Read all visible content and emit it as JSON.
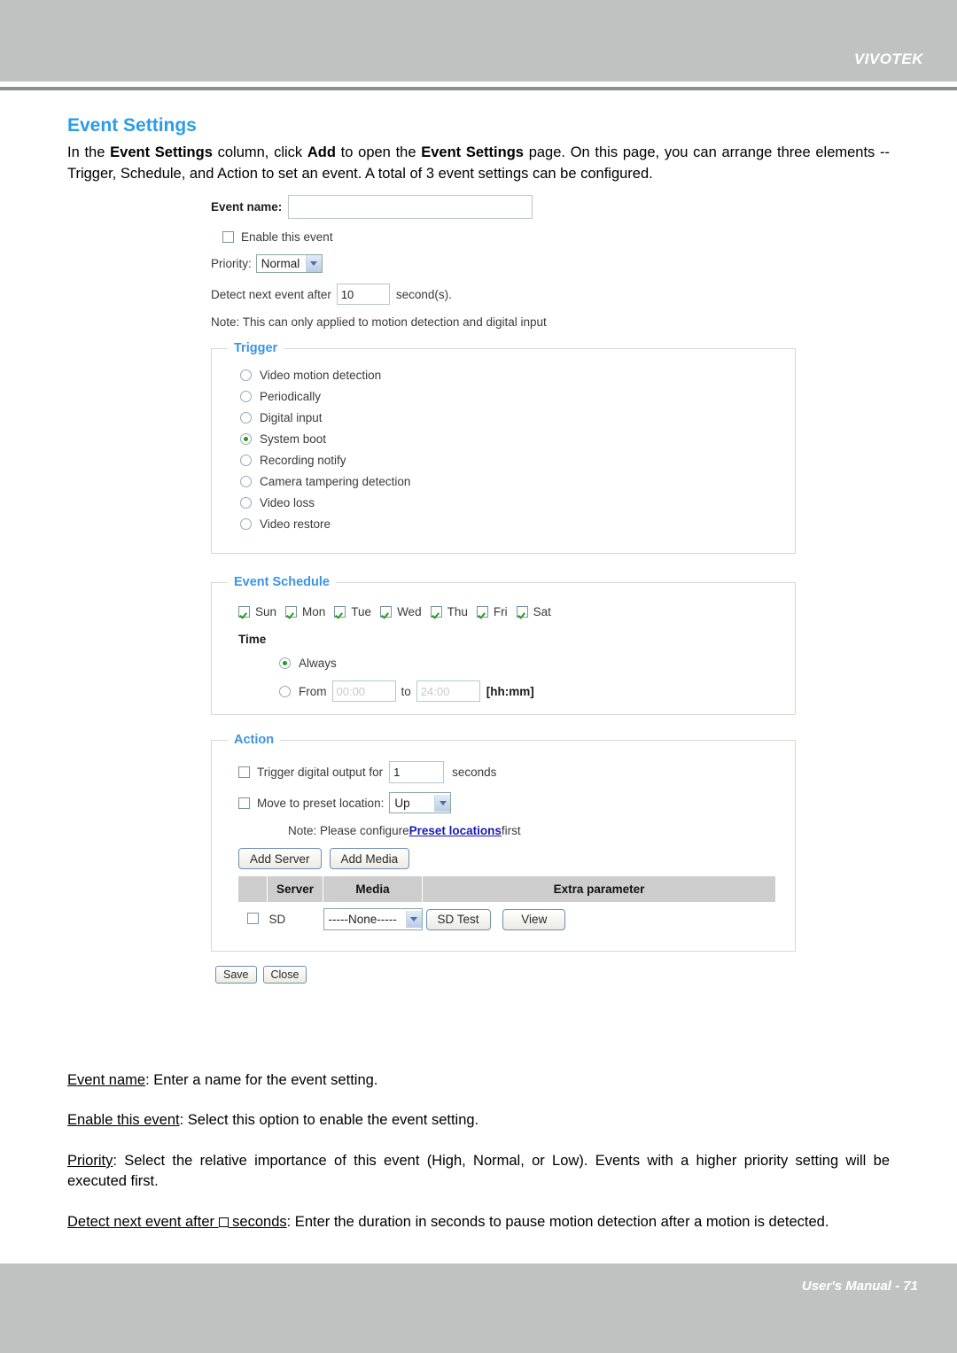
{
  "page": {
    "brand": "VIVOTEK",
    "footer": "User's Manual - 71"
  },
  "doc": {
    "title": "Event Settings",
    "intro_1": "In the ",
    "intro_b1": "Event Settings",
    "intro_2": " column, click ",
    "intro_b2": "Add",
    "intro_3": " to open the ",
    "intro_b3": "Event Settings",
    "intro_4": " page. On this page, you can arrange three elements -- Trigger, Schedule, and Action to set an event. A total of 3 event settings can be configured."
  },
  "form": {
    "event_name_label": "Event name:",
    "event_name_value": "",
    "enable_label": "Enable this event",
    "enable_checked": false,
    "priority_label": "Priority:",
    "priority_value": "Normal",
    "priority_options": [
      "High",
      "Normal",
      "Low"
    ],
    "detect_label": "Detect next event after",
    "detect_value": "10",
    "detect_suffix": "second(s).",
    "note": "Note: This can only applied to motion detection and digital input"
  },
  "trigger": {
    "legend": "Trigger",
    "selected": "System boot",
    "options": [
      {
        "label": "Video motion detection",
        "checked": false
      },
      {
        "label": "Periodically",
        "checked": false
      },
      {
        "label": "Digital input",
        "checked": false
      },
      {
        "label": "System boot",
        "checked": true
      },
      {
        "label": "Recording notify",
        "checked": false
      },
      {
        "label": "Camera tampering detection",
        "checked": false
      },
      {
        "label": "Video loss",
        "checked": false
      },
      {
        "label": "Video restore",
        "checked": false
      }
    ]
  },
  "schedule": {
    "legend": "Event Schedule",
    "days": [
      {
        "label": "Sun",
        "checked": true
      },
      {
        "label": "Mon",
        "checked": true
      },
      {
        "label": "Tue",
        "checked": true
      },
      {
        "label": "Wed",
        "checked": true
      },
      {
        "label": "Thu",
        "checked": true
      },
      {
        "label": "Fri",
        "checked": true
      },
      {
        "label": "Sat",
        "checked": true
      }
    ],
    "time_label": "Time",
    "always_label": "Always",
    "always_checked": true,
    "from_label": "From",
    "from_checked": false,
    "from_value": "",
    "from_placeholder": "00:00",
    "to_label": "to",
    "to_value": "",
    "to_placeholder": "24:00",
    "format_label": "[hh:mm]"
  },
  "action": {
    "legend": "Action",
    "trigger_do_label": "Trigger digital output for",
    "trigger_do_checked": false,
    "trigger_do_value": "1",
    "trigger_do_suffix": "seconds",
    "preset_label": "Move to preset location:",
    "preset_checked": false,
    "preset_value": "Up",
    "note_prefix": "Note: Please configure ",
    "note_link": "Preset locations",
    "note_suffix": " first",
    "add_server_label": "Add Server",
    "add_media_label": "Add Media",
    "table": {
      "headers": [
        "",
        "Server",
        "Media",
        "Extra parameter"
      ],
      "rows": [
        {
          "checked": false,
          "server": "SD",
          "media": "-----None-----",
          "buttons": [
            "SD Test",
            "View"
          ],
          "extra": ""
        }
      ]
    }
  },
  "footer_buttons": {
    "save": "Save",
    "close": "Close"
  },
  "descriptions": {
    "d1_term": "Event name",
    "d1_text": ": Enter a name for the event setting.",
    "d2_term": "Enable this event",
    "d2_text": ": Select this option to enable the event setting.",
    "d3_term": "Priority",
    "d3_text": ": Select the relative importance of this event (High, Normal, or Low). Events with a higher priority setting will be executed first.",
    "d4_term_a": "Detect next event after ",
    "d4_term_b": " seconds",
    "d4_text": ": Enter the duration in seconds to pause motion detection after a motion is detected."
  }
}
